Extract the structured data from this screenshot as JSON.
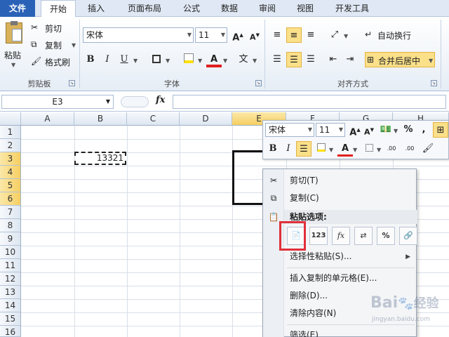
{
  "tabs": [
    "文件",
    "开始",
    "插入",
    "页面布局",
    "公式",
    "数据",
    "审阅",
    "视图",
    "开发工具"
  ],
  "clipboard": {
    "paste": "粘贴",
    "cut": "剪切",
    "copy": "复制",
    "format_painter": "格式刷",
    "label": "剪贴板"
  },
  "font": {
    "name": "宋体",
    "size": "11",
    "bold": "B",
    "italic": "I",
    "underline": "U",
    "font_color_glyph": "A",
    "wen": "文",
    "grow": "A",
    "shrink": "A",
    "label": "字体"
  },
  "alignment": {
    "wrap_text": "自动换行",
    "merge_center": "合并后居中",
    "label": "对齐方式"
  },
  "formula_bar": {
    "name_box": "E3",
    "fx": "fx",
    "value": ""
  },
  "grid": {
    "columns": [
      "A",
      "B",
      "C",
      "D",
      "E",
      "F",
      "G",
      "H"
    ],
    "rows": [
      "1",
      "2",
      "3",
      "4",
      "5",
      "6",
      "7",
      "8",
      "9",
      "10",
      "11",
      "12",
      "13",
      "14",
      "15",
      "16"
    ],
    "cell_b3": "13321"
  },
  "mini_toolbar": {
    "font": "宋体",
    "size": "11",
    "bold": "B",
    "italic": "I",
    "percent": "%",
    "comma": ",",
    "grow": "A",
    "shrink": "A",
    "font_color": "A",
    "inc_decimal": ".00",
    "dec_decimal": ".00"
  },
  "context_menu": {
    "cut": "剪切(T)",
    "copy": "复制(C)",
    "paste_options": "粘贴选项:",
    "paste_options_icons": [
      "123",
      "fx",
      "%"
    ],
    "paste_special": "选择性粘贴(S)...",
    "insert_copied": "插入复制的单元格(E)...",
    "delete": "删除(D)...",
    "clear": "清除内容(N)",
    "filter": "筛选(E)"
  },
  "watermark": {
    "brand": "Bai",
    "brand_suffix": "经验",
    "url": "jingyan.baidu.com"
  },
  "colors": {
    "file_tab": "#2a62b7",
    "selected_header": "#f6cf62",
    "highlight": "#e0303a",
    "ribbon_bg": "#e6edf6"
  }
}
